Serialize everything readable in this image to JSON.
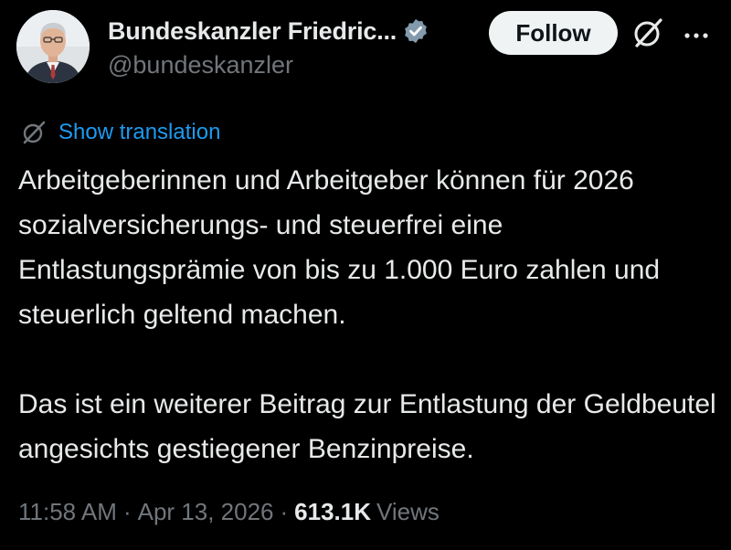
{
  "author": {
    "display_name": "Bundeskanzler Friedric...",
    "handle": "@bundeskanzler",
    "avatar_icon": "portrait-avatar",
    "verified_badge": "verified-badge-icon",
    "verified_color": "#829aab"
  },
  "actions": {
    "follow_label": "Follow",
    "grok_icon": "grok-icon",
    "more_icon": "more-options-icon"
  },
  "translation": {
    "icon": "grok-icon",
    "link_label": "Show translation",
    "link_color": "#1d9bf0"
  },
  "post": {
    "paragraphs": [
      "Arbeitgeberinnen und Arbeitgeber können für 2026 sozialversicherungs- und steuerfrei eine Entlastungsprämie von bis zu 1.000 Euro zahlen und steuerlich geltend machen.",
      "Das ist ein weiterer Beitrag zur Entlastung der Geldbeutel angesichts gestiegener Benzinpreise."
    ]
  },
  "meta": {
    "time": "11:58 AM",
    "date": "Apr 13, 2026",
    "views_count": "613.1K",
    "views_label": "Views",
    "separator": "·"
  },
  "colors": {
    "background": "#000000",
    "text_primary": "#e7e9ea",
    "text_secondary": "#71767b",
    "button_bg": "#eff3f4"
  }
}
